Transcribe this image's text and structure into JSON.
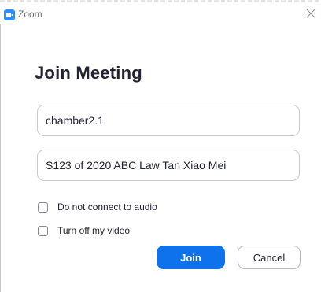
{
  "window": {
    "title": "Zoom",
    "close_icon": "close-icon",
    "app_icon": "zoom-logo-icon"
  },
  "dialog": {
    "heading": "Join Meeting",
    "meeting_id_value": "chamber2.1",
    "display_name_value": "S123 of 2020 ABC Law Tan Xiao Mei",
    "options": [
      {
        "label": "Do not connect to audio",
        "checked": false
      },
      {
        "label": "Turn off my video",
        "checked": false
      }
    ],
    "join_label": "Join",
    "cancel_label": "Cancel"
  },
  "colors": {
    "accent": "#0e72ed",
    "brand": "#2d8cff"
  }
}
